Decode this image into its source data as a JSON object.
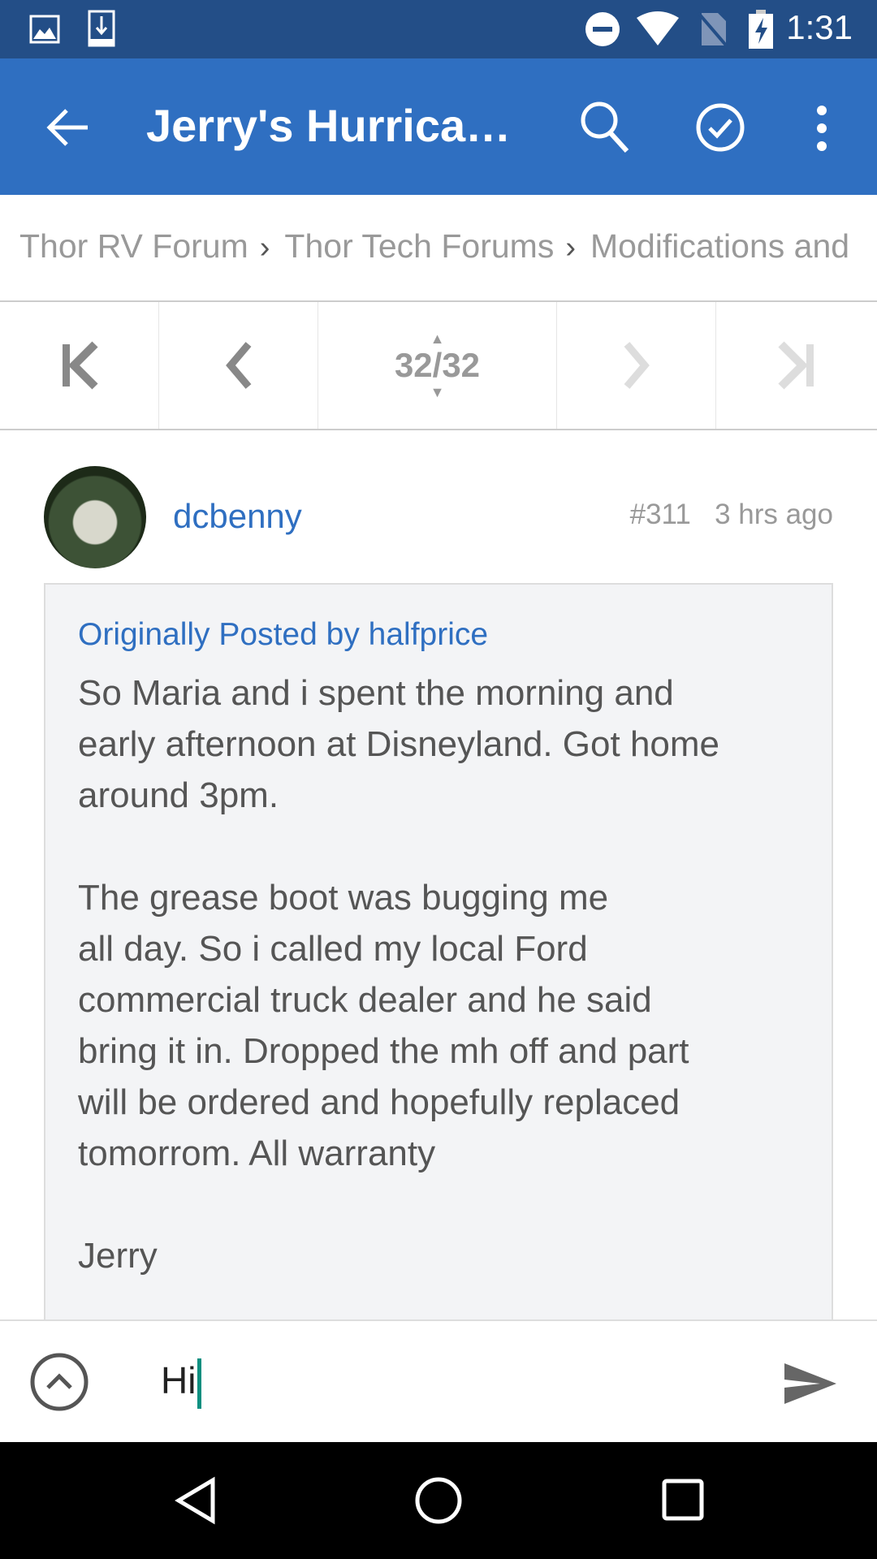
{
  "status_bar": {
    "time": "1:31",
    "icons": [
      "image-icon",
      "download-icon",
      "dnd-icon",
      "wifi-icon",
      "no-sim-icon",
      "battery-charging-icon"
    ]
  },
  "app_bar": {
    "title": "Jerry's Hurricane...",
    "icons": [
      "back-arrow-icon",
      "search-icon",
      "check-circle-icon",
      "more-vert-icon"
    ],
    "color": "#2f6fc1"
  },
  "breadcrumb": [
    "Thor RV Forum",
    "Thor Tech Forums",
    "Modifications and"
  ],
  "pager": {
    "page": "32/32"
  },
  "post": {
    "username": "dcbenny",
    "number": "#311",
    "time": "3 hrs ago",
    "quote": {
      "by": "Originally Posted by halfprice",
      "text": "So Maria and i spent the morning and\nearly afternoon at Disneyland. Got home\naround 3pm.\n\nThe grease boot was bugging me\nall day. So i called my local Ford\ncommercial truck dealer and he said\nbring it in. Dropped the mh off and part\nwill be ordered and hopefully replaced\ntomorrom. All warranty\n\nJerry"
    }
  },
  "reply": {
    "value": "Hi"
  }
}
